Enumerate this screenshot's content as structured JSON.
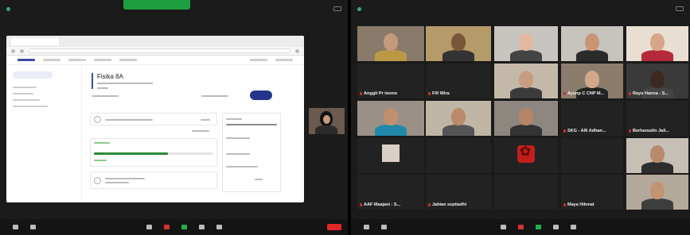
{
  "left_window": {
    "toolbar_buttons": [
      {
        "icon": "mic-icon",
        "color": "#bbbbbb"
      },
      {
        "icon": "video-icon",
        "color": "#bbbbbb"
      },
      {
        "icon": "participants-icon",
        "color": "#bbbbbb"
      },
      {
        "icon": "chat-icon",
        "color": "#d33333"
      },
      {
        "icon": "share-screen-icon",
        "color": "#22b14c"
      },
      {
        "icon": "record-icon",
        "color": "#bbbbbb"
      },
      {
        "icon": "reactions-icon",
        "color": "#bbbbbb"
      }
    ],
    "shared_screen": {
      "course_title": "Fisika 8A",
      "progress_fraction": 0.62
    }
  },
  "right_window": {
    "participants": [
      {
        "name": "",
        "bg": "#8a7a6c",
        "skin": "#c49a7c",
        "shirt": "#b94"
      },
      {
        "name": "",
        "bg": "#b59a6a",
        "skin": "#7a5638",
        "shirt": "#333"
      },
      {
        "name": "",
        "bg": "#c8c4c0",
        "skin": "#e2b9a0",
        "shirt": "#444"
      },
      {
        "name": "",
        "bg": "#c7c3bd",
        "skin": "#c89572",
        "shirt": "#2a2a2a"
      },
      {
        "name": "",
        "bg": "#e9ded2",
        "skin": "#d7a58a",
        "shirt": "#b52a3a"
      },
      {
        "name": "Anggit Pr iwono",
        "bg": "",
        "skin": "",
        "shirt": ""
      },
      {
        "name": "Fifi Wira",
        "bg": "",
        "skin": "",
        "shirt": ""
      },
      {
        "name": "",
        "bg": "#c4b8a8",
        "skin": "#c89c80",
        "shirt": "#3b3b3b"
      },
      {
        "name": "Ayunp C CNP M...",
        "bg": "#8c7c6c",
        "skin": "#d2a88c",
        "shirt": "#222"
      },
      {
        "name": "Rayu Hanna - S...",
        "bg": "#3a3a3a",
        "skin": "#3c2a22",
        "shirt": "#444"
      },
      {
        "name": "",
        "bg": "#9a9087",
        "skin": "#c0906e",
        "shirt": "#28a"
      },
      {
        "name": "",
        "bg": "#bfb6a6",
        "skin": "#ba8a6a",
        "shirt": "#555"
      },
      {
        "name": "",
        "bg": "#8e8780",
        "skin": "#b48566",
        "shirt": "#333"
      },
      {
        "name": "SKG - Alfi Adhan...",
        "bg": "",
        "skin": "",
        "shirt": ""
      },
      {
        "name": "Berhanudin Jail...",
        "bg": "",
        "skin": "",
        "shirt": ""
      },
      {
        "name": "",
        "bg": "#c6bfb6",
        "skin": "#b88a6c",
        "shirt": "#2d2d2d"
      },
      {
        "name": "AAF Maajani - S...",
        "bg": "",
        "skin": "",
        "shirt": ""
      },
      {
        "name": "Jabian septiadhi",
        "bg": "",
        "skin": "",
        "shirt": ""
      },
      {
        "name": "Maya Hikmat",
        "bg": "",
        "skin": "",
        "shirt": ""
      }
    ],
    "toolbar_buttons": [
      {
        "icon": "mic-icon",
        "color": "#bbbbbb"
      },
      {
        "icon": "video-icon",
        "color": "#bbbbbb"
      },
      {
        "icon": "participants-icon",
        "color": "#bbbbbb"
      },
      {
        "icon": "chat-icon",
        "color": "#d33333"
      },
      {
        "icon": "share-screen-icon",
        "color": "#22b14c"
      },
      {
        "icon": "record-icon",
        "color": "#bbbbbb"
      },
      {
        "icon": "reactions-icon",
        "color": "#bbbbbb"
      }
    ]
  },
  "colors": {
    "accent_green": "#1e9e3e",
    "end_red": "#e02828",
    "brand_blue": "#24358c",
    "progress_green": "#2e8b3a"
  }
}
